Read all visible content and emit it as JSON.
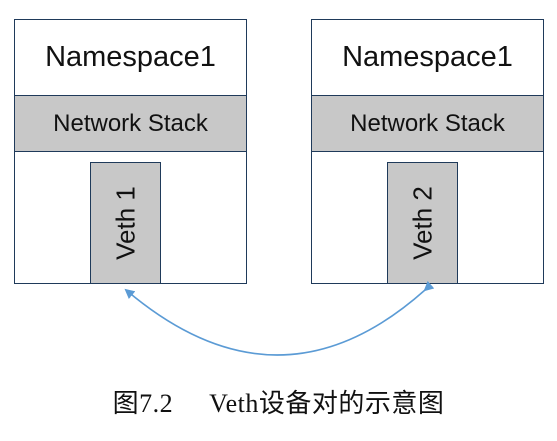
{
  "diagram": {
    "left_namespace": {
      "title": "Namespace1",
      "stack_label": "Network Stack",
      "veth_label": "Veth 1"
    },
    "right_namespace": {
      "title": "Namespace1",
      "stack_label": "Network Stack",
      "veth_label": "Veth 2"
    },
    "connector": {
      "type": "bidirectional-arc",
      "color": "#5b9bd5"
    }
  },
  "caption": {
    "figure_number": "图7.2",
    "text": "Veth设备对的示意图"
  },
  "colors": {
    "box_border": "#1f3a5a",
    "fill_gray": "#c8c8c8",
    "arrow": "#5b9bd5"
  }
}
